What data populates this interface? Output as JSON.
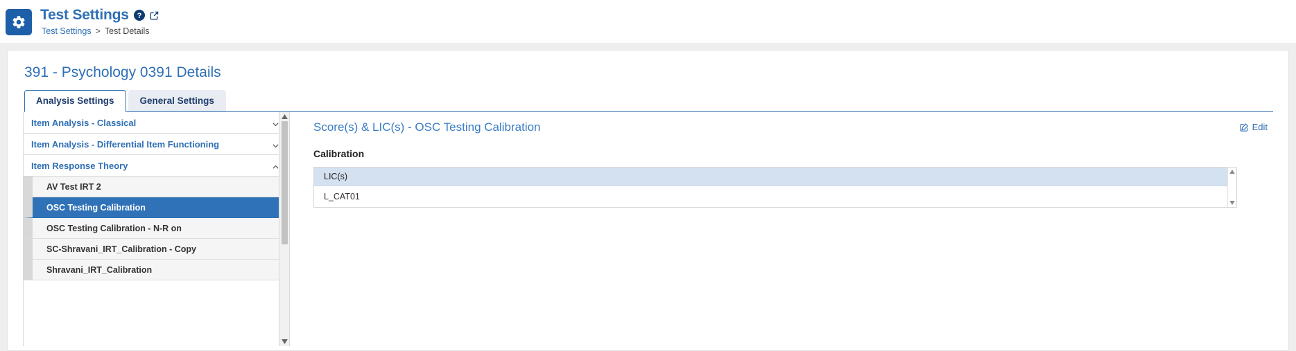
{
  "header": {
    "app_title": "Test Settings",
    "help_icon": "question-circle-icon",
    "external_link_icon": "external-link-icon",
    "gear_icon": "gear-icon",
    "breadcrumb": {
      "root": "Test Settings",
      "separator": ">",
      "current": "Test Details"
    }
  },
  "page": {
    "title": "391 - Psychology 0391 Details"
  },
  "tabs": [
    {
      "label": "Analysis Settings",
      "active": true
    },
    {
      "label": "General Settings",
      "active": false
    }
  ],
  "sidebar": {
    "sections": [
      {
        "label": "Item Analysis - Classical",
        "expanded": false,
        "chevron": "chevron-down-icon"
      },
      {
        "label": "Item Analysis - Differential Item Functioning",
        "expanded": false,
        "chevron": "chevron-down-icon"
      },
      {
        "label": "Item Response Theory",
        "expanded": true,
        "chevron": "chevron-up-icon"
      }
    ],
    "items": [
      {
        "label": "AV Test IRT 2",
        "selected": false
      },
      {
        "label": "OSC Testing Calibration",
        "selected": true
      },
      {
        "label": "OSC Testing Calibration - N-R on",
        "selected": false
      },
      {
        "label": "SC-Shravani_IRT_Calibration - Copy",
        "selected": false
      },
      {
        "label": "Shravani_IRT_Calibration",
        "selected": false
      }
    ]
  },
  "detail": {
    "title": "Score(s) & LIC(s) - OSC Testing Calibration",
    "edit_label": "Edit",
    "edit_icon": "pencil-square-icon",
    "section_label": "Calibration",
    "table": {
      "columns": [
        "LIC(s)"
      ],
      "rows": [
        [
          "L_CAT01"
        ]
      ]
    }
  },
  "colors": {
    "brand_blue": "#2f6fb5",
    "selected_row": "#2f72b8",
    "table_header": "#d4e1f0",
    "page_bg": "#eeeeee"
  }
}
